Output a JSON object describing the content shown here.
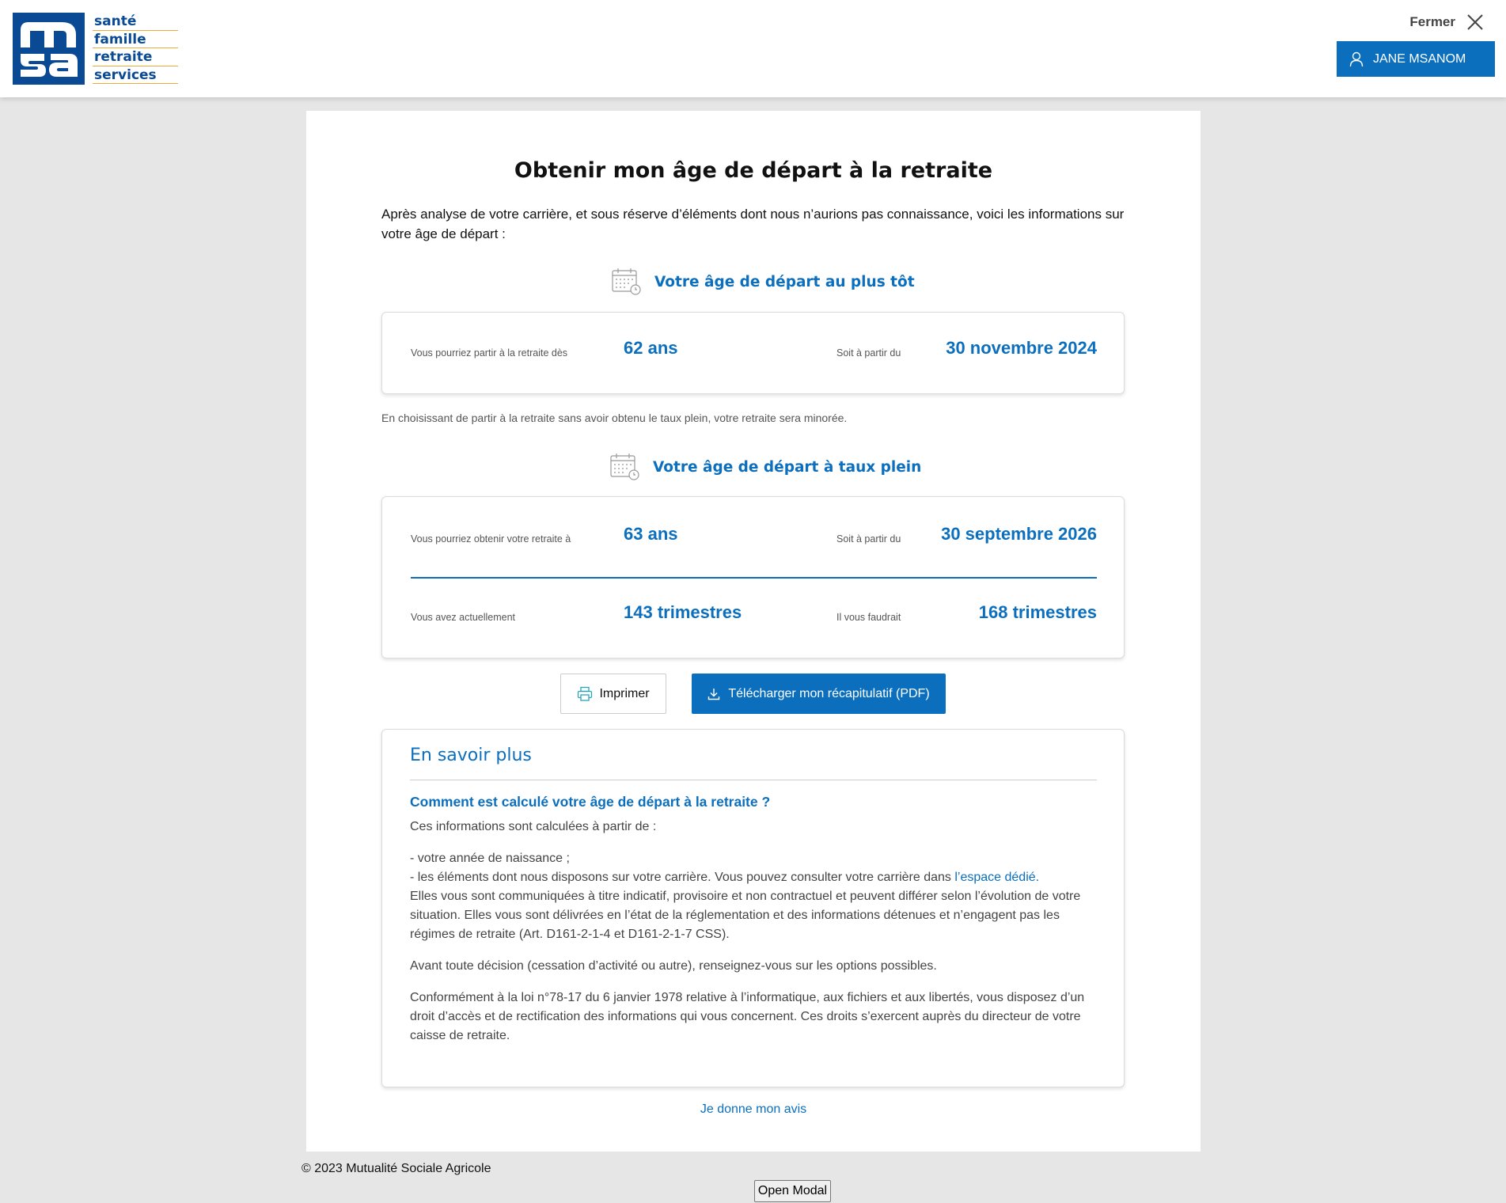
{
  "header": {
    "logo_letters": "msa",
    "logo_words": [
      "santé",
      "famille",
      "retraite",
      "services"
    ],
    "close_label": "Fermer",
    "user_name": "JANE MSANOM"
  },
  "page": {
    "title": "Obtenir mon âge de départ à la retraite",
    "intro": "Après analyse de votre carrière, et sous réserve d’éléments dont nous n’aurions pas connaissance, voici les informations sur votre âge de départ :"
  },
  "earliest": {
    "heading": "Votre âge de départ au plus tôt",
    "left_label": "Vous pourriez partir à la retraite dès",
    "left_value": "62 ans",
    "right_label": "Soit à partir du",
    "right_value": "30 novembre 2024",
    "note": "En choisissant de partir à la retraite sans avoir obtenu le taux plein, votre retraite sera minorée."
  },
  "full_rate": {
    "heading": "Votre âge de départ à taux plein",
    "row1": {
      "left_label": "Vous pourriez obtenir votre retraite à",
      "left_value": "63 ans",
      "right_label": "Soit à partir du",
      "right_value": "30 septembre 2026"
    },
    "row2": {
      "left_label": "Vous avez actuellement",
      "left_value": "143 trimestres",
      "right_label": "Il vous faudrait",
      "right_value": "168 trimestres"
    }
  },
  "actions": {
    "print_label": "Imprimer",
    "download_label": "Télécharger mon récapitulatif (PDF)"
  },
  "learn_more": {
    "title": "En savoir plus",
    "question": "Comment est calculé votre âge de départ à la retraite ?",
    "p1": "Ces informations sont calculées à partir de :",
    "bullet1": "- votre année de naissance ;",
    "bullet2_prefix": "- les éléments dont nous disposons sur votre carrière. Vous pouvez consulter votre carrière dans ",
    "bullet2_link": "l’espace dédié",
    "bullet2_suffix": ".",
    "p2": "Elles vous sont communiquées à titre indicatif, provisoire et non contractuel et peuvent différer selon l’évolution de votre situation. Elles vous sont délivrées en l’état de la réglementation et des informations détenues et n’engagent pas les régimes de retraite (Art. D161-2-1-4 et D161-2-1-7 CSS).",
    "p3": "Avant toute décision (cessation d’activité ou autre), renseignez-vous sur les options possibles.",
    "p4": "Conformément à la loi n°78-17 du 6 janvier 1978 relative à l’informatique, aux fichiers et aux libertés, vous disposez d’un droit d’accès et de rectification des informations qui vous concernent. Ces droits s’exercent auprès du directeur de votre caisse de retraite."
  },
  "feedback_label": "Je donne mon avis",
  "footer": {
    "copyright": "© 2023 Mutualité Sociale Agricole",
    "open_modal_label": "Open Modal"
  },
  "colors": {
    "brand_blue": "#0b6fbe",
    "logo_blue": "#0a4a94",
    "logo_accent": "#f2a93b",
    "background": "#e6e6e6"
  },
  "icons": [
    "user-icon",
    "close-icon",
    "calendar-icon",
    "printer-icon",
    "download-icon"
  ]
}
